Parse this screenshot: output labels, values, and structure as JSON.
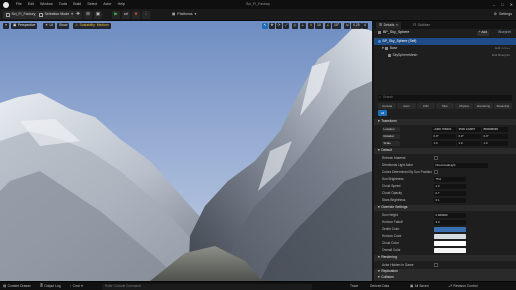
{
  "window": {
    "title": "Sci_Fi_Factory",
    "menu": [
      "File",
      "Edit",
      "Window",
      "Tools",
      "Build",
      "Select",
      "Actor",
      "Help"
    ],
    "controls": [
      "–",
      "□",
      "✕"
    ]
  },
  "toolbar": {
    "level_tab": "Sci_Fi_Factory_White_Box",
    "selection_mode": "Selection Mode",
    "platforms": "Platforms",
    "settings": "Settings"
  },
  "viewport": {
    "perspective": "Perspective",
    "lit": "Lit",
    "show": "Show",
    "scalability": "Scalability: Medium",
    "grid_snap": "10",
    "rot_snap": "10°",
    "scale_snap": "0.25",
    "camera_speed": "4"
  },
  "panels": {
    "tab_details": "Details",
    "tab_outliner": "Outliner",
    "actor_name": "BP_Sky_Sphere",
    "add_label": "+ Add",
    "blueprint_label": "Blueprint",
    "tree": [
      {
        "label": "BP_Sky_Sphere (Self)",
        "edit": "",
        "selected": true
      },
      {
        "label": "Base",
        "edit": "Edit in C++",
        "selected": false
      },
      {
        "label": "SkySphereMesh",
        "edit": "Edit Blueprint",
        "selected": false
      }
    ],
    "search_placeholder": "Search",
    "filter_tabs": [
      "General",
      "Actor",
      "LOD",
      "Misc",
      "Physics",
      "Rendering",
      "Streaming"
    ],
    "filter_all": "All"
  },
  "transform": {
    "header": "Transform",
    "location": {
      "label": "Location",
      "x": "-2306.766602",
      "y": "3506.132957",
      "z": "880008096"
    },
    "rotation": {
      "label": "Rotation",
      "x": "0.0°",
      "y": "0.0°",
      "z": "0.0°"
    },
    "scale": {
      "label": "Scale",
      "x": "1.0",
      "y": "1.0",
      "z": "1.0"
    }
  },
  "default": {
    "header": "Default",
    "rows": [
      {
        "label": "Refresh Material",
        "value": ""
      },
      {
        "label": "Directional Light Actor",
        "value": "DirectionalLight"
      },
      {
        "label": "Colors Determined By Sun Position",
        "value": ""
      },
      {
        "label": "Sun Brightness",
        "value": "75.0"
      },
      {
        "label": "Cloud Speed",
        "value": "1.0"
      },
      {
        "label": "Cloud Opacity",
        "value": "0.7"
      },
      {
        "label": "Stars Brightness",
        "value": "0.1"
      }
    ]
  },
  "override": {
    "header": "Override Settings",
    "rows": [
      {
        "label": "Sun Height",
        "value": "0.669926"
      },
      {
        "label": "Horizon Falloff",
        "value": "3.0"
      }
    ],
    "colors": [
      {
        "label": "Zenith Color",
        "color": "#3a6fb0"
      },
      {
        "label": "Horizon Color",
        "color": "#d8dde2"
      },
      {
        "label": "Cloud Color",
        "color": "#ffffff"
      },
      {
        "label": "Overall Color",
        "color": "#f4f4f4"
      }
    ]
  },
  "rendering": {
    "header": "Rendering",
    "row": "Actor Hidden In Game"
  },
  "replication": {
    "header": "Replication",
    "row": "Net Load on Client"
  },
  "collision": {
    "header": "Collision"
  },
  "statusbar": {
    "content_drawer": "Content Drawer",
    "output_log": "Output Log",
    "cmd": "Cmd",
    "cmd_placeholder": "Enter Console Command",
    "trace": "Trace",
    "derived_data": "Derived Data",
    "all_saved": "All Saved",
    "revision_control": "Revision Control"
  },
  "colors": {
    "accent": "#1e6fb8",
    "play_green": "#3fbf4a",
    "warning": "#e8c23a",
    "sky_top": "#6f8dc2",
    "sky_bottom": "#b7c7e0",
    "rock_dark": "#4a4f57",
    "snow": "#e9edf2"
  }
}
